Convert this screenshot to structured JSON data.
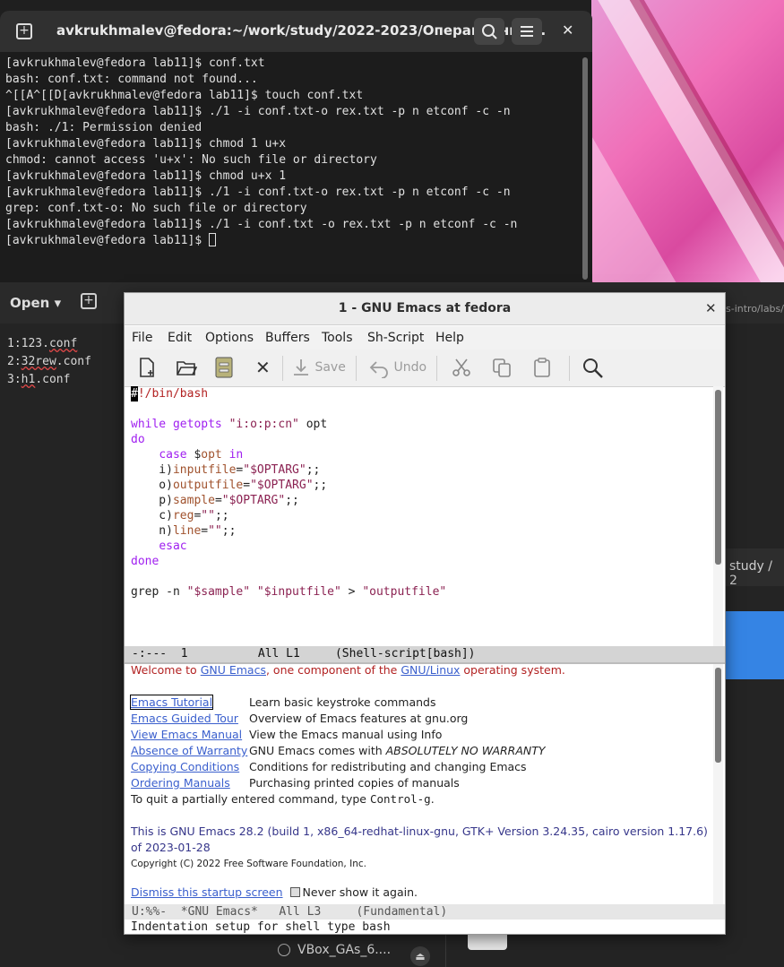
{
  "terminal": {
    "title": "avkrukhmalev@fedora:~/work/study/2022-2023/Операционны...",
    "lines": [
      "[avkrukhmalev@fedora lab11]$ conf.txt",
      "bash: conf.txt: command not found...",
      "^[[A^[[D[avkrukhmalev@fedora lab11]$ touch conf.txt",
      "[avkrukhmalev@fedora lab11]$ ./1 -i conf.txt-o rex.txt -p n etconf -c -n",
      "bash: ./1: Permission denied",
      "[avkrukhmalev@fedora lab11]$ chmod 1 u+x",
      "chmod: cannot access 'u+x': No such file or directory",
      "[avkrukhmalev@fedora lab11]$ chmod u+x 1",
      "[avkrukhmalev@fedora lab11]$ ./1 -i conf.txt-o rex.txt -p n etconf -c -n",
      "grep: conf.txt-o: No such file or directory",
      "[avkrukhmalev@fedora lab11]$ ./1 -i conf.txt -o rex.txt -p n etconf -c -n"
    ],
    "prompt": "[avkrukhmalev@fedora lab11]$ "
  },
  "background_editor": {
    "open_label": "Open",
    "line1_num": "1:",
    "line1_pre": "123.",
    "line1_sq": "conf",
    "line2_num": "2:",
    "line2_sq": "32rew",
    "line2_post": ".conf",
    "line3_num": "3:",
    "line3_sq": "h1",
    "line3_post": ".conf",
    "path_fragment": "s-intro/labs/",
    "study_label": "study  /  2",
    "bottom_item": "VBox_GAs_6...."
  },
  "emacs": {
    "title": "1 - GNU Emacs at fedora",
    "menu": [
      "File",
      "Edit",
      "Options",
      "Buffers",
      "Tools",
      "Sh-Script",
      "Help"
    ],
    "toolbar": {
      "save": "Save",
      "undo": "Undo"
    },
    "modeline1": "-:---  1          All L1     (Shell-script[bash])",
    "modeline2": "U:%%-  *GNU Emacs*   All L3     (Fundamental)",
    "echo": "Indentation setup for shell type bash",
    "welcome": {
      "w1": "Welcome to ",
      "w2": "GNU Emacs",
      "w3": ", one component of the ",
      "w4": "GNU/Linux",
      "w5": " operating system.",
      "links": [
        {
          "label": "Emacs Tutorial",
          "desc": "Learn basic keystroke commands"
        },
        {
          "label": "Emacs Guided Tour",
          "desc": "Overview of Emacs features at gnu.org"
        },
        {
          "label": "View Emacs Manual",
          "desc": "View the Emacs manual using Info"
        },
        {
          "label": "Absence of Warranty",
          "desc_pre": "GNU Emacs comes with ",
          "desc_em": "ABSOLUTELY NO WARRANTY"
        },
        {
          "label": "Copying Conditions",
          "desc": "Conditions for redistributing and changing Emacs"
        },
        {
          "label": "Ordering Manuals",
          "desc": "Purchasing printed copies of manuals"
        }
      ],
      "quit_pre": "To quit a partially entered command, type ",
      "quit_key": "Control-g",
      "quit_post": ".",
      "version1": "This is GNU Emacs 28.2 (build 1, x86_64-redhat-linux-gnu, GTK+ Version 3.24.35, cairo version 1.17.6)",
      "version2": " of 2023-01-28",
      "copyright": "Copyright (C) 2022 Free Software Foundation, Inc.",
      "dismiss": "Dismiss this startup screen",
      "never": "Never show it again."
    }
  }
}
